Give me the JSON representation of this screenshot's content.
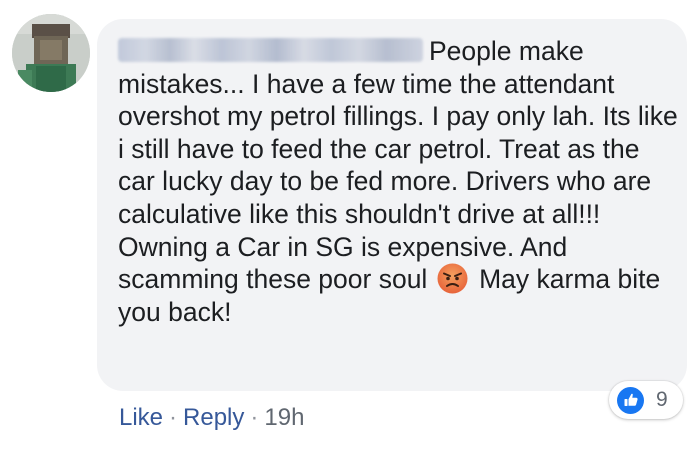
{
  "comment": {
    "text_line1": "People make",
    "text_body": "mistakes... I have a few time the attendant overshot my petrol fillings. I pay only lah. Its like i still have to feed the car petrol. Treat as the car lucky day to be fed more. Drivers who are calculative like this shouldn't drive at all!!! Owning a Car in SG is expensive. And scamming these poor soul",
    "text_end": "May karma bite you back!",
    "emoji": "angry-face"
  },
  "reactions": {
    "type": "like",
    "count": "9"
  },
  "actions": {
    "like_label": "Like",
    "separator": "·",
    "reply_label": "Reply",
    "timestamp": "19h"
  },
  "colors": {
    "bubble": "#f2f3f5",
    "text": "#1c1e21",
    "link": "#365899",
    "meta": "#606770",
    "like_blue": "#1877f2"
  }
}
